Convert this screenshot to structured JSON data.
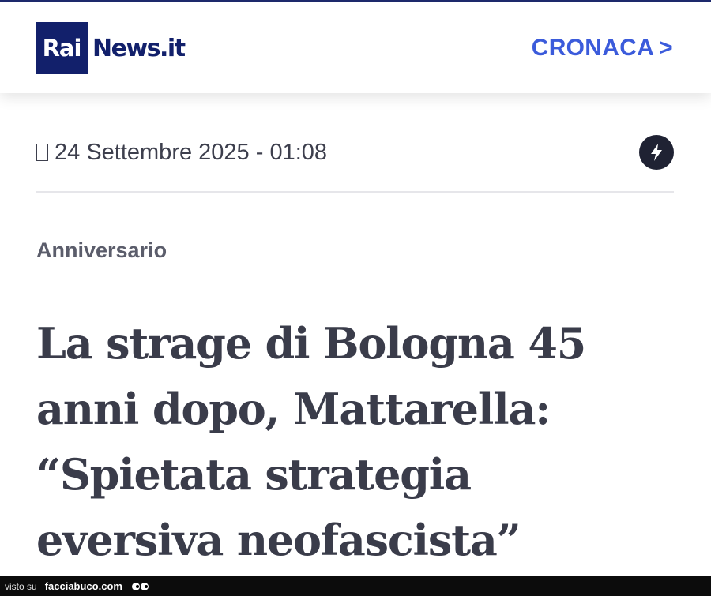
{
  "header": {
    "logo_rai": "Rai",
    "logo_news": "News.it",
    "section_label": "CRONACA",
    "section_arrow": ">",
    "brand_color": "#12206b",
    "link_color": "#3b5bdb"
  },
  "meta": {
    "date_time": "24 Settembre 2025 - 01:08",
    "date_icon": "clock-icon",
    "action_icon": "bolt-icon"
  },
  "article": {
    "kicker": "Anniversario",
    "headline": "La strage di Bologna 45 anni dopo, Mattarella: “Spietata strategia eversiva neofascista”"
  },
  "watermark": {
    "prefix": "visto su",
    "site": "facciabuco.com"
  }
}
